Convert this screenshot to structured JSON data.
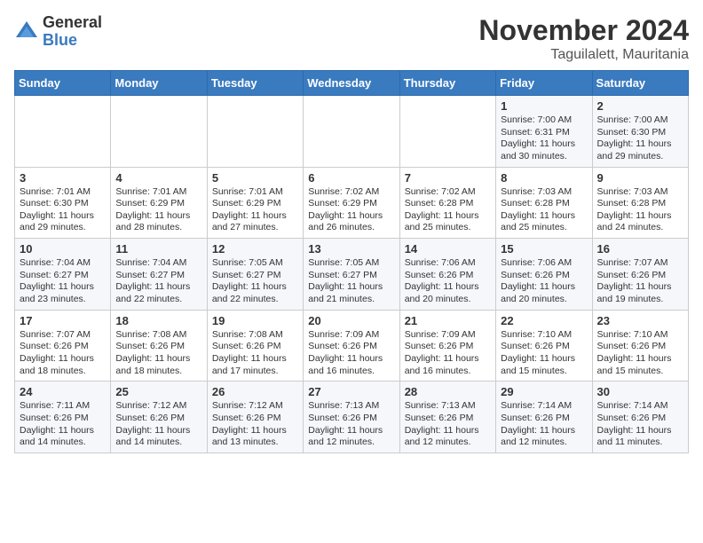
{
  "header": {
    "logo_general": "General",
    "logo_blue": "Blue",
    "month_title": "November 2024",
    "location": "Taguilalett, Mauritania"
  },
  "weekdays": [
    "Sunday",
    "Monday",
    "Tuesday",
    "Wednesday",
    "Thursday",
    "Friday",
    "Saturday"
  ],
  "weeks": [
    [
      {
        "day": "",
        "info": ""
      },
      {
        "day": "",
        "info": ""
      },
      {
        "day": "",
        "info": ""
      },
      {
        "day": "",
        "info": ""
      },
      {
        "day": "",
        "info": ""
      },
      {
        "day": "1",
        "info": "Sunrise: 7:00 AM\nSunset: 6:31 PM\nDaylight: 11 hours and 30 minutes."
      },
      {
        "day": "2",
        "info": "Sunrise: 7:00 AM\nSunset: 6:30 PM\nDaylight: 11 hours and 29 minutes."
      }
    ],
    [
      {
        "day": "3",
        "info": "Sunrise: 7:01 AM\nSunset: 6:30 PM\nDaylight: 11 hours and 29 minutes."
      },
      {
        "day": "4",
        "info": "Sunrise: 7:01 AM\nSunset: 6:29 PM\nDaylight: 11 hours and 28 minutes."
      },
      {
        "day": "5",
        "info": "Sunrise: 7:01 AM\nSunset: 6:29 PM\nDaylight: 11 hours and 27 minutes."
      },
      {
        "day": "6",
        "info": "Sunrise: 7:02 AM\nSunset: 6:29 PM\nDaylight: 11 hours and 26 minutes."
      },
      {
        "day": "7",
        "info": "Sunrise: 7:02 AM\nSunset: 6:28 PM\nDaylight: 11 hours and 25 minutes."
      },
      {
        "day": "8",
        "info": "Sunrise: 7:03 AM\nSunset: 6:28 PM\nDaylight: 11 hours and 25 minutes."
      },
      {
        "day": "9",
        "info": "Sunrise: 7:03 AM\nSunset: 6:28 PM\nDaylight: 11 hours and 24 minutes."
      }
    ],
    [
      {
        "day": "10",
        "info": "Sunrise: 7:04 AM\nSunset: 6:27 PM\nDaylight: 11 hours and 23 minutes."
      },
      {
        "day": "11",
        "info": "Sunrise: 7:04 AM\nSunset: 6:27 PM\nDaylight: 11 hours and 22 minutes."
      },
      {
        "day": "12",
        "info": "Sunrise: 7:05 AM\nSunset: 6:27 PM\nDaylight: 11 hours and 22 minutes."
      },
      {
        "day": "13",
        "info": "Sunrise: 7:05 AM\nSunset: 6:27 PM\nDaylight: 11 hours and 21 minutes."
      },
      {
        "day": "14",
        "info": "Sunrise: 7:06 AM\nSunset: 6:26 PM\nDaylight: 11 hours and 20 minutes."
      },
      {
        "day": "15",
        "info": "Sunrise: 7:06 AM\nSunset: 6:26 PM\nDaylight: 11 hours and 20 minutes."
      },
      {
        "day": "16",
        "info": "Sunrise: 7:07 AM\nSunset: 6:26 PM\nDaylight: 11 hours and 19 minutes."
      }
    ],
    [
      {
        "day": "17",
        "info": "Sunrise: 7:07 AM\nSunset: 6:26 PM\nDaylight: 11 hours and 18 minutes."
      },
      {
        "day": "18",
        "info": "Sunrise: 7:08 AM\nSunset: 6:26 PM\nDaylight: 11 hours and 18 minutes."
      },
      {
        "day": "19",
        "info": "Sunrise: 7:08 AM\nSunset: 6:26 PM\nDaylight: 11 hours and 17 minutes."
      },
      {
        "day": "20",
        "info": "Sunrise: 7:09 AM\nSunset: 6:26 PM\nDaylight: 11 hours and 16 minutes."
      },
      {
        "day": "21",
        "info": "Sunrise: 7:09 AM\nSunset: 6:26 PM\nDaylight: 11 hours and 16 minutes."
      },
      {
        "day": "22",
        "info": "Sunrise: 7:10 AM\nSunset: 6:26 PM\nDaylight: 11 hours and 15 minutes."
      },
      {
        "day": "23",
        "info": "Sunrise: 7:10 AM\nSunset: 6:26 PM\nDaylight: 11 hours and 15 minutes."
      }
    ],
    [
      {
        "day": "24",
        "info": "Sunrise: 7:11 AM\nSunset: 6:26 PM\nDaylight: 11 hours and 14 minutes."
      },
      {
        "day": "25",
        "info": "Sunrise: 7:12 AM\nSunset: 6:26 PM\nDaylight: 11 hours and 14 minutes."
      },
      {
        "day": "26",
        "info": "Sunrise: 7:12 AM\nSunset: 6:26 PM\nDaylight: 11 hours and 13 minutes."
      },
      {
        "day": "27",
        "info": "Sunrise: 7:13 AM\nSunset: 6:26 PM\nDaylight: 11 hours and 12 minutes."
      },
      {
        "day": "28",
        "info": "Sunrise: 7:13 AM\nSunset: 6:26 PM\nDaylight: 11 hours and 12 minutes."
      },
      {
        "day": "29",
        "info": "Sunrise: 7:14 AM\nSunset: 6:26 PM\nDaylight: 11 hours and 12 minutes."
      },
      {
        "day": "30",
        "info": "Sunrise: 7:14 AM\nSunset: 6:26 PM\nDaylight: 11 hours and 11 minutes."
      }
    ]
  ]
}
